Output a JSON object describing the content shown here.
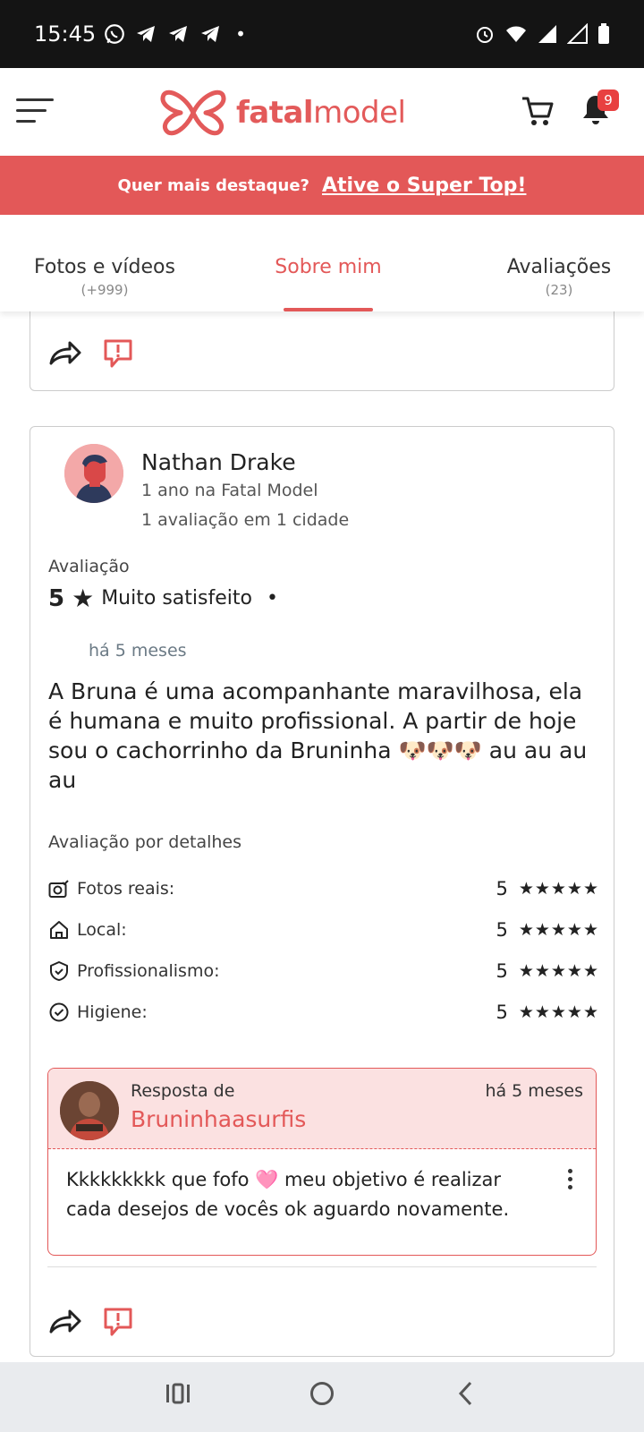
{
  "status": {
    "time": "15:45"
  },
  "header": {
    "logo_bold": "fatal",
    "logo_light": "model",
    "notif_count": "9"
  },
  "promo": {
    "question": "Quer mais destaque?",
    "cta": "Ative o Super Top!"
  },
  "tabs": [
    {
      "label": "Fotos e vídeos",
      "count": "(+999)"
    },
    {
      "label": "Sobre mim",
      "count": ""
    },
    {
      "label": "Avaliações",
      "count": "(23)"
    }
  ],
  "review": {
    "user": "Nathan Drake",
    "tenure": "1 ano na Fatal Model",
    "stats": "1 avaliação em 1 cidade",
    "rating_label": "Avaliação",
    "score": "5",
    "score_text": "Muito satisfeito",
    "ago": "há 5 meses",
    "text": "A Bruna é uma acompanhante maravilhosa, ela é humana e muito profissional. A partir de hoje sou o cachorrinho da Bruninha 🐶🐶🐶 au au au au",
    "details_label": "Avaliação por detalhes",
    "details": [
      {
        "label": "Fotos reais:",
        "value": "5",
        "icon": "camera-check-icon"
      },
      {
        "label": "Local:",
        "value": "5",
        "icon": "home-icon"
      },
      {
        "label": "Profissionalismo:",
        "value": "5",
        "icon": "shield-check-icon"
      },
      {
        "label": "Higiene:",
        "value": "5",
        "icon": "check-circle-icon"
      }
    ],
    "stars": "★★★★★"
  },
  "reply": {
    "from": "Resposta de",
    "name": "Bruninhaasurfis",
    "ago": "há 5 meses",
    "text": "Kkkkkkkkk que fofo 🩷 meu objetivo é realizar cada desejos de vocês ok aguardo novamente."
  },
  "colors": {
    "brand": "#e35858",
    "status_bar": "#141414"
  }
}
